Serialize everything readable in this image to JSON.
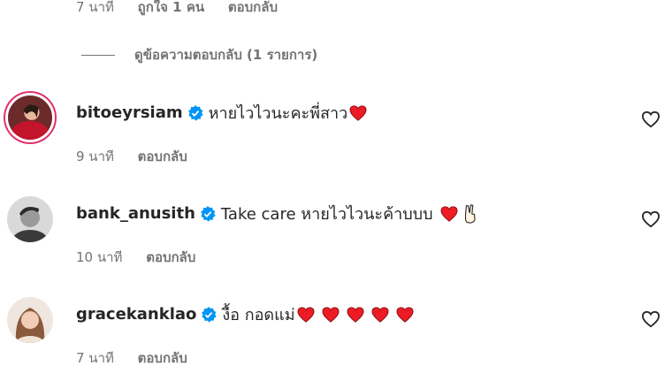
{
  "top_meta": {
    "time": "7 นาที",
    "likes": "ถูกใจ 1 คน",
    "reply": "ตอบกลับ"
  },
  "view_replies": "ดูข้อความตอบกลับ (1 รายการ)",
  "comments": [
    {
      "username": "bitoeyrsiam",
      "text": "หายไวไวนะคะพี่สาว",
      "hearts": 1,
      "time": "9 นาที",
      "reply": "ตอบกลับ"
    },
    {
      "username": "bank_anusith",
      "text": "Take care หายไวไวนะค้าบบบ",
      "hearts": 1,
      "extra_emoji": "victory-hand",
      "time": "10 นาที",
      "reply": "ตอบกลับ"
    },
    {
      "username": "gracekanklao",
      "text": "งื้อ กอดแม่",
      "hearts": 5,
      "time": "7 นาที",
      "reply": "ตอบกลับ"
    }
  ],
  "colors": {
    "verified": "#0095f6",
    "heart": "#ed1c24",
    "muted": "#737373",
    "story_ring": "#e1306c"
  },
  "icons": [
    "verified-badge-icon",
    "heart-emoji-icon",
    "like-heart-icon",
    "victory-hand-icon"
  ]
}
